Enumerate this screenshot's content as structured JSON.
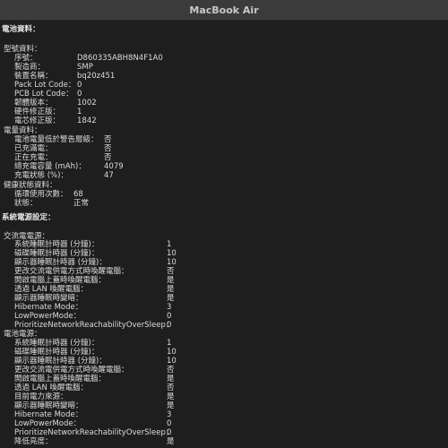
{
  "window": {
    "title": "MacBook Air"
  },
  "battery_info_heading": "電池資料：",
  "model_info": {
    "heading": "型號資料：",
    "rows": [
      {
        "label": "序號：",
        "value": "D860335ABH8N4F1A0"
      },
      {
        "label": "製造商：",
        "value": "SMP"
      },
      {
        "label": "裝置名稱：",
        "value": "bq20z451"
      },
      {
        "label": "Pack Lot Code：",
        "value": "0"
      },
      {
        "label": "PCB Lot Code：",
        "value": "0"
      },
      {
        "label": "韌體版本：",
        "value": "1002"
      },
      {
        "label": "硬件修正版：",
        "value": "1"
      },
      {
        "label": "電芯修正版：",
        "value": "1842"
      }
    ]
  },
  "charge_info": {
    "heading": "電量資料：",
    "rows": [
      {
        "label": "電池電量低於警告層級：",
        "value": "否"
      },
      {
        "label": "已充滿電：",
        "value": "否"
      },
      {
        "label": "正在充電：",
        "value": "否"
      },
      {
        "label": "總充電容量 (mAh)：",
        "value": "4079"
      },
      {
        "label": "充電狀態 (%)：",
        "value": "47"
      }
    ]
  },
  "health_info": {
    "heading": "健康狀態資料：",
    "rows": [
      {
        "label": "循環使用次數：",
        "value": "68"
      },
      {
        "label": "狀態：",
        "value": "正常"
      }
    ]
  },
  "power_settings_heading": "系統電源設定：",
  "ac_power": {
    "heading": "交流電電源：",
    "rows": [
      {
        "label": "系統睡眠計時器 (分鐘)：",
        "value": "1"
      },
      {
        "label": "磁碟睡眠計時器 (分鐘)：",
        "value": "10"
      },
      {
        "label": "顯示器睡眠計時器 (分鐘)：",
        "value": "10"
      },
      {
        "label": "更改交流電供電方式時喚醒電腦：",
        "value": "否"
      },
      {
        "label": "開啟電腦上蓋時喚醒電腦：",
        "value": "是"
      },
      {
        "label": "透過 LAN 喚醒電腦：",
        "value": "是"
      },
      {
        "label": "顯示器睡眠時變暗：",
        "value": "是"
      },
      {
        "label": "Hibernate Mode：",
        "value": "3"
      },
      {
        "label": "LowPowerMode：",
        "value": "0"
      },
      {
        "label": "PrioritizeNetworkReachabilityOverSleep：",
        "value": "0"
      }
    ]
  },
  "battery_power": {
    "heading": "電池電源：",
    "rows": [
      {
        "label": "系統睡眠計時器 (分鐘)：",
        "value": "1"
      },
      {
        "label": "磁碟睡眠計時器 (分鐘)：",
        "value": "10"
      },
      {
        "label": "顯示器睡眠計時器 (分鐘)：",
        "value": "10"
      },
      {
        "label": "更改交流電供電方式時喚醒電腦：",
        "value": "否"
      },
      {
        "label": "開啟電腦上蓋時喚醒電腦：",
        "value": "是"
      },
      {
        "label": "透過 LAN 喚醒電腦：",
        "value": "否"
      },
      {
        "label": "目前電力來源：",
        "value": "是"
      },
      {
        "label": "顯示器睡眠時變暗：",
        "value": "是"
      },
      {
        "label": "Hibernate Mode：",
        "value": "3"
      },
      {
        "label": "LowPowerMode：",
        "value": "0"
      },
      {
        "label": "PrioritizeNetworkReachabilityOverSleep：",
        "value": "0"
      },
      {
        "label": "降低亮度：",
        "value": "是"
      }
    ]
  }
}
